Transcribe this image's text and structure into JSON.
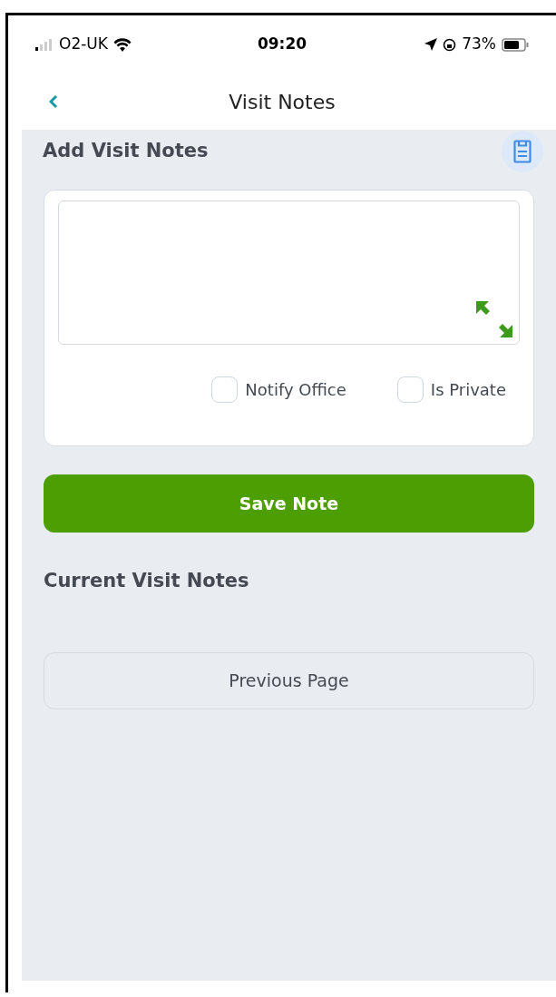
{
  "status_bar": {
    "carrier": "O2-UK",
    "time": "09:20",
    "battery": "73%"
  },
  "nav": {
    "title": "Visit Notes"
  },
  "add_section": {
    "title": "Add Visit Notes",
    "checkboxes": [
      {
        "label": "Notify Office",
        "checked": false
      },
      {
        "label": "Is Private",
        "checked": false
      }
    ]
  },
  "save_button": "Save Note",
  "current_section": {
    "title": "Current Visit Notes"
  },
  "previous_button": "Previous Page"
}
